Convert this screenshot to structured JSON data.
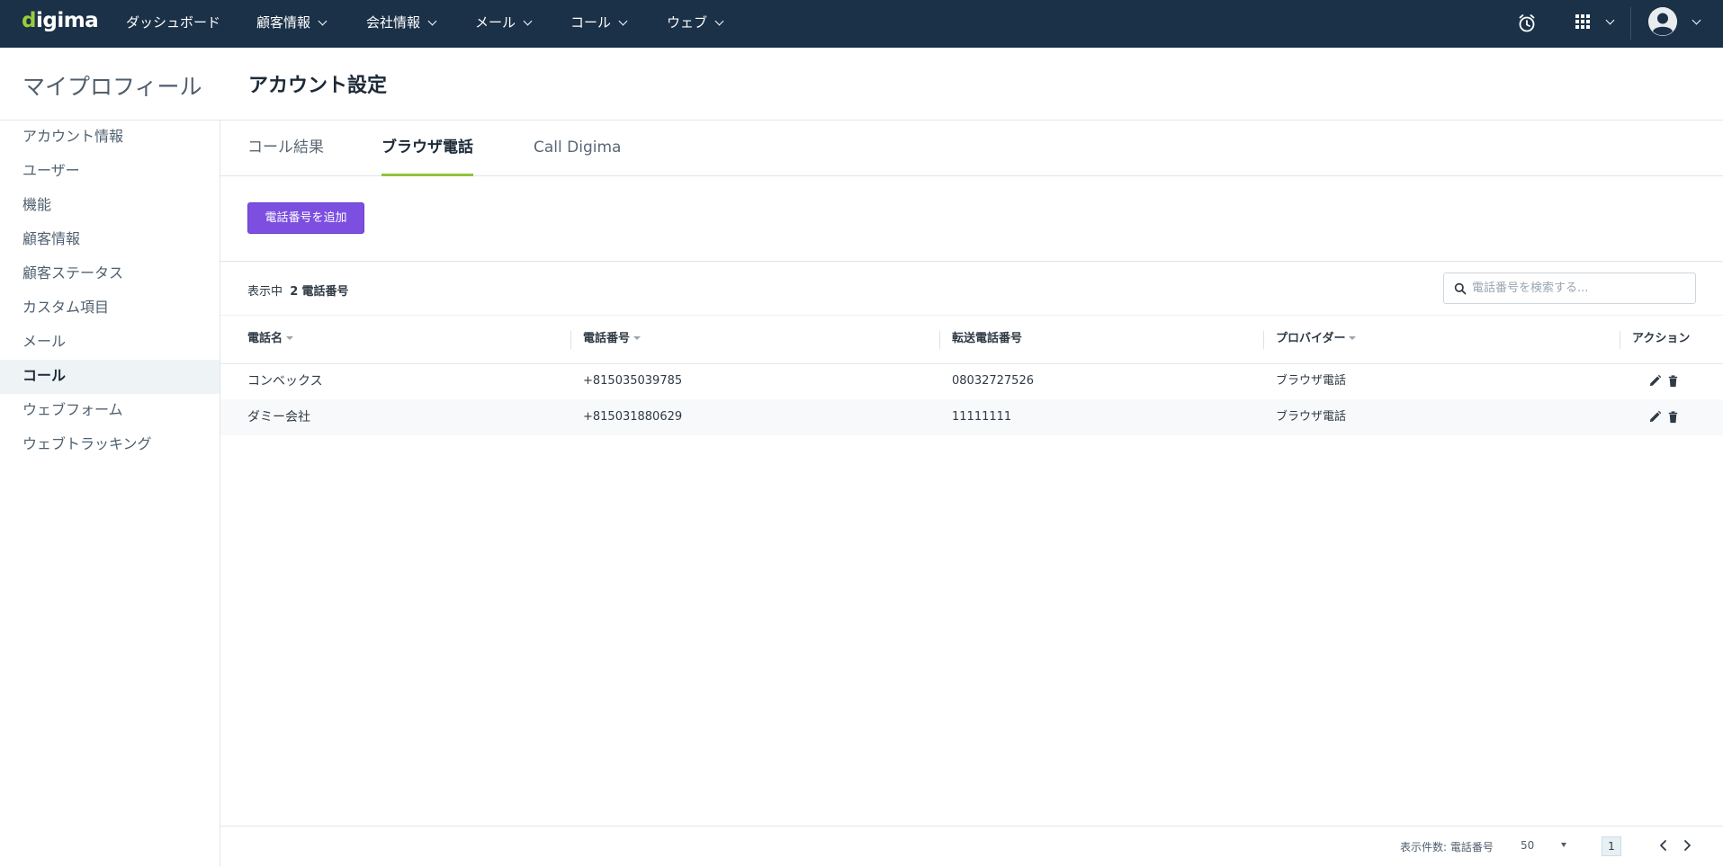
{
  "nav": {
    "logo": "digima",
    "items": [
      {
        "label": "ダッシュボード",
        "dropdown": false
      },
      {
        "label": "顧客情報",
        "dropdown": true
      },
      {
        "label": "会社情報",
        "dropdown": true
      },
      {
        "label": "メール",
        "dropdown": true
      },
      {
        "label": "コール",
        "dropdown": true
      },
      {
        "label": "ウェブ",
        "dropdown": true
      }
    ],
    "icons": [
      "alarm-clock-icon",
      "apps-grid-icon",
      "user-avatar-icon"
    ]
  },
  "header": {
    "left_title": "マイプロフィール",
    "title": "アカウント設定"
  },
  "sidebar": {
    "items": [
      {
        "label": "アカウント情報",
        "active": false
      },
      {
        "label": "ユーザー",
        "active": false
      },
      {
        "label": "機能",
        "active": false
      },
      {
        "label": "顧客情報",
        "active": false
      },
      {
        "label": "顧客ステータス",
        "active": false
      },
      {
        "label": "カスタム項目",
        "active": false
      },
      {
        "label": "メール",
        "active": false
      },
      {
        "label": "コール",
        "active": true
      },
      {
        "label": "ウェブフォーム",
        "active": false
      },
      {
        "label": "ウェブトラッキング",
        "active": false
      }
    ]
  },
  "tabs": [
    {
      "label": "コール結果",
      "active": false
    },
    {
      "label": "ブラウザ電話",
      "active": true
    },
    {
      "label": "Call Digima",
      "active": false
    }
  ],
  "actions": {
    "add_phone": "電話番号を追加"
  },
  "summary": {
    "prefix": "表示中",
    "count": "2",
    "suffix": "電話番号"
  },
  "search": {
    "placeholder": "電話番号を検索する...",
    "value": ""
  },
  "table": {
    "columns": [
      "電話名",
      "電話番号",
      "転送電話番号",
      "プロバイダー",
      "アクション"
    ],
    "rows": [
      {
        "name": "コンベックス",
        "number": "+815035039785",
        "forward": "08032727526",
        "provider": "ブラウザ電話"
      },
      {
        "name": "ダミー会社",
        "number": "+815031880629",
        "forward": "11111111",
        "provider": "ブラウザ電話"
      }
    ]
  },
  "footer": {
    "per_page_label": "表示件数: 電話番号",
    "per_page_value": "50",
    "current_page": "1"
  },
  "colors": {
    "nav_bg": "#1b3148",
    "accent_green": "#8ec43c",
    "button_purple": "#7c4fe0",
    "active_sidebar_bg": "#eef4f6"
  }
}
